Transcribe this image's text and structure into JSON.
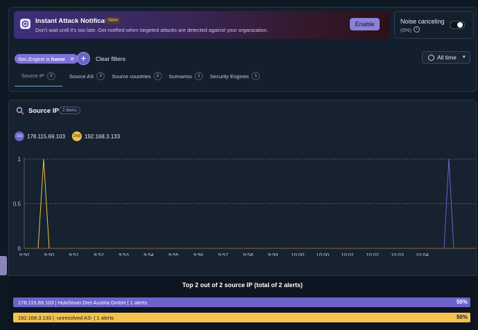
{
  "banner": {
    "title": "Instant Attack Notification",
    "badge": "New",
    "subtitle": "Don't wait until it's too late. Get notified when targeted attacks are detected against your organization.",
    "enable_label": "Enable"
  },
  "noise": {
    "label": "Noise canceling",
    "percent": "(0%)",
    "enabled": false
  },
  "filters": {
    "chip_prefix": "Sec.Engine is",
    "chip_value": "home",
    "clear_label": "Clear filters",
    "time_label": "All time"
  },
  "tabs": [
    {
      "label": "Source IP",
      "count": "2",
      "active": true
    },
    {
      "label": "Source AS",
      "count": "2"
    },
    {
      "label": "Source countries",
      "count": "2"
    },
    {
      "label": "Scenarios",
      "count": "1"
    },
    {
      "label": "Security Engines",
      "count": "1"
    }
  ],
  "section": {
    "title": "Source IP",
    "items_badge": "2 items"
  },
  "legend": [
    {
      "rank": "1st",
      "ip": "178.115.69.103",
      "color": "#6c63c9"
    },
    {
      "rank": "2nd",
      "ip": "192.168.3.133",
      "color": "#f1c24a"
    }
  ],
  "chart_data": {
    "type": "line",
    "x": [
      "9:50",
      "9:50",
      "9:51",
      "9:52",
      "9:53",
      "9:54",
      "9:55",
      "9:56",
      "9:57",
      "9:58",
      "9:59",
      "10:00",
      "10:00",
      "10:01",
      "10:02",
      "10:03",
      "10:04"
    ],
    "ylim": [
      0,
      1
    ],
    "yticks": [
      "1",
      "0.5",
      "0"
    ],
    "grid": true,
    "series": [
      {
        "name": "178.115.69.103",
        "color": "#6c63c9",
        "peak_x": "10:04",
        "peak_y": 1
      },
      {
        "name": "192.168.3.133",
        "color": "#f1c24a",
        "peak_x": "9:50",
        "peak_y": 1
      }
    ]
  },
  "summary": {
    "title": "Top 2 out of 2 source IP (total of 2 alerts)",
    "rows": [
      {
        "text": "178.115.69.103 | Hutchison Drei Austria GmbH  | 1 alerts",
        "pct": "50%",
        "color": "#6c63c9"
      },
      {
        "text": "192.168.3.133 | -unresolved AS-  | 1 alerts",
        "pct": "50%",
        "color": "#f5c34c"
      }
    ]
  }
}
